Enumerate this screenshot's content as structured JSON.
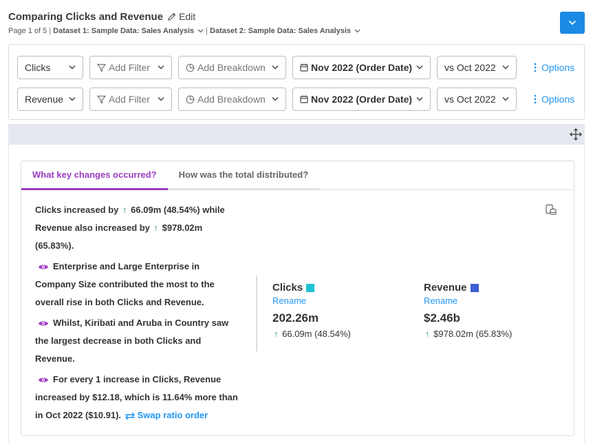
{
  "header": {
    "title": "Comparing Clicks and Revenue",
    "edit_label": "Edit",
    "page_info": "Page 1 of 5",
    "dataset1": "Dataset 1: Sample Data: Sales Analysis",
    "dataset2": "Dataset 2: Sample Data: Sales Analysis"
  },
  "controls": {
    "row1": {
      "metric": "Clicks",
      "filter": "Add Filter",
      "breakdown": "Add Breakdown",
      "date": "Nov 2022 (Order Date)",
      "compare": "vs Oct 2022",
      "options": "Options"
    },
    "row2": {
      "metric": "Revenue",
      "filter": "Add Filter",
      "breakdown": "Add Breakdown",
      "date": "Nov 2022 (Order Date)",
      "compare": "vs Oct 2022",
      "options": "Options"
    }
  },
  "tabs": {
    "active": "What key changes occurred?",
    "inactive": "How was the total distributed?"
  },
  "narrative": {
    "p1_a": "Clicks increased by",
    "p1_b": "66.09m (48.54%) while Revenue also increased by",
    "p1_c": "$978.02m (65.83%).",
    "p2": "Enterprise and Large Enterprise in Company Size contributed the most to the overall rise in both Clicks and Revenue.",
    "p3": "Whilst, Kiribati and Aruba in Country saw the largest decrease in both Clicks and Revenue.",
    "p4": "For every 1 increase in Clicks, Revenue increased by $12.18, which is 11.64% more than in Oct 2022 ($10.91).",
    "swap_label": "Swap ratio order"
  },
  "metrics": {
    "clicks": {
      "name": "Clicks",
      "rename": "Rename",
      "value": "202.26m",
      "change": "66.09m (48.54%)",
      "color": "#1fc2d4"
    },
    "revenue": {
      "name": "Revenue",
      "rename": "Rename",
      "value": "$2.46b",
      "change": "$978.02m (65.83%)",
      "color": "#3b5fd4"
    }
  },
  "icons": {
    "edit": "pencil-icon",
    "dataset_chevron": "chevron-down-icon",
    "dropdown_button": "chevron-down-icon",
    "filter": "funnel-icon",
    "breakdown": "pie-icon",
    "date": "calendar-icon",
    "options": "kebab-icon",
    "move": "move-arrows-icon",
    "insight": "eye-icon",
    "up": "arrow-up-icon",
    "swap": "swap-arrows-icon",
    "data": "database-icon"
  },
  "colors": {
    "accent_blue": "#1a8ae5",
    "link_blue": "#2196f3",
    "active_tab": "#9c3ac2",
    "positive": "#2e9e4f"
  }
}
